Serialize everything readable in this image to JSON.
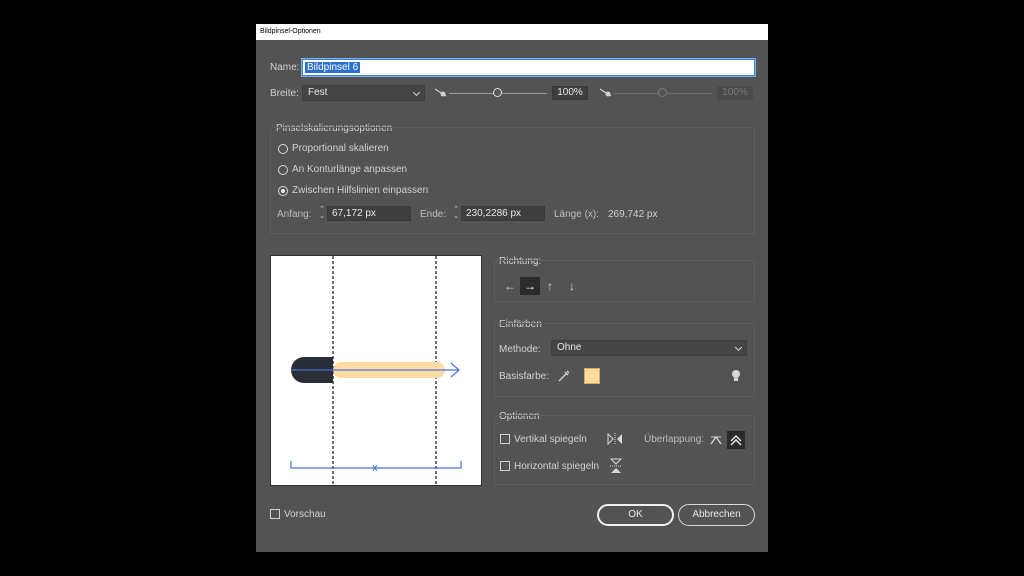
{
  "window": {
    "title": "Bildpinsel-Optionen"
  },
  "name": {
    "label": "Name:",
    "value": "Bildpinsel 6"
  },
  "width_row": {
    "label": "Breite:",
    "dropdown_value": "Fest",
    "slider_value": "100%",
    "slider2_value": "100%"
  },
  "scaling": {
    "title": "Pinselskalierungsoptionen",
    "options": [
      "Proportional skalieren",
      "An Konturlänge anpassen",
      "Zwischen Hilfslinien einpassen"
    ],
    "selected_index": 2,
    "start_label": "Anfang:",
    "start_value": "67,172 px",
    "end_label": "Ende:",
    "end_value": "230,2286 px",
    "length_label": "Länge (x):",
    "length_value": "269,742 px"
  },
  "direction": {
    "title": "Richtung:",
    "buttons": [
      "←",
      "→",
      "↑",
      "↓"
    ],
    "active_index": 1
  },
  "colorize": {
    "title": "Einfärben",
    "method_label": "Methode:",
    "method_value": "Ohne",
    "base_color_label": "Basisfarbe:",
    "base_color": "#ffdba3"
  },
  "options": {
    "title": "Optionen",
    "flip_vertical_label": "Vertikal spiegeln",
    "flip_horizontal_label": "Horizontal spiegeln",
    "overlap_label": "Überlappung:"
  },
  "preview_checkbox_label": "Vorschau",
  "buttons": {
    "ok": "OK",
    "cancel": "Abbrechen"
  },
  "colors": {
    "accent": "#2c6fcf",
    "guide_line": "#4a72d8",
    "brush_dark": "#2a2e36",
    "brush_light": "#ffdba3"
  }
}
